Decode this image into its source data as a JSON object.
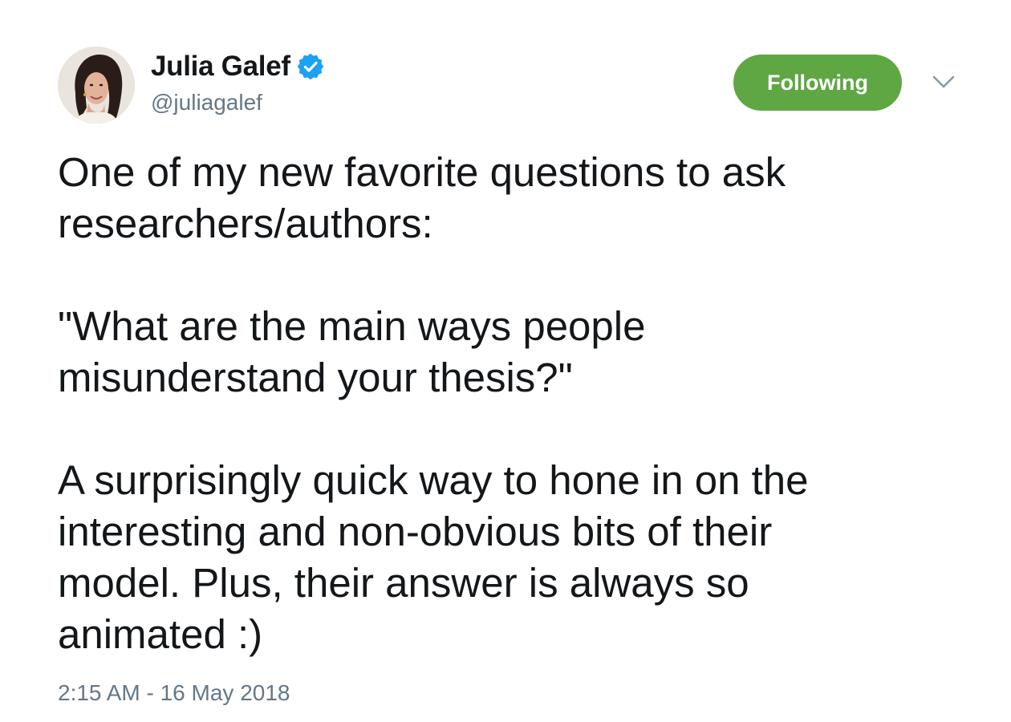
{
  "author": {
    "name": "Julia Galef",
    "handle": "@juliagalef",
    "verified_icon": "verified-badge-icon",
    "avatar_icon": "profile-photo"
  },
  "follow_button": {
    "label": "Following",
    "color": "#5ea743"
  },
  "menu": {
    "icon": "chevron-down-icon"
  },
  "tweet": {
    "lines": [
      "One of my new favorite questions to ask",
      "researchers/authors:",
      "\"What are the main ways people",
      "misunderstand your thesis?\"",
      "A surprisingly quick way to hone in on the",
      "interesting and non-obvious bits of their",
      "model. Plus, their answer is always so",
      "animated :)"
    ],
    "timestamp": "2:15 AM - 16 May 2018"
  },
  "colors": {
    "text": "#14171a",
    "secondary_text": "#657786",
    "verified_blue": "#1da1f2"
  }
}
